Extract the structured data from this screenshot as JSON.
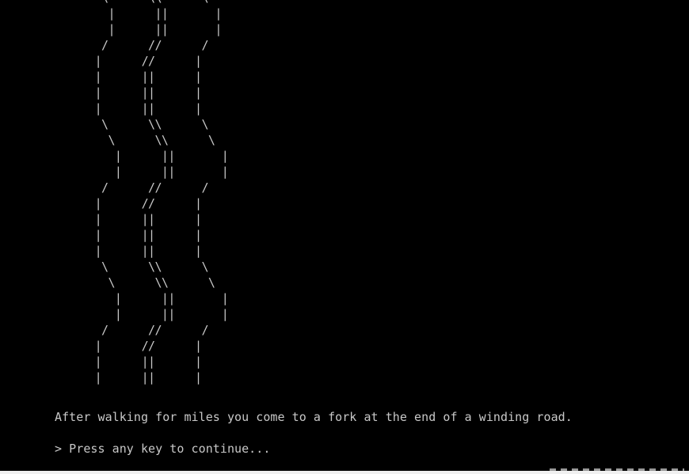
{
  "console": {
    "ascii_art": "       \\      \\\\      \\\n        |      ||       |\n        |      ||       |\n       /      //      /\n      |      //      |\n      |      ||      |\n      |      ||      |\n      |      ||      |\n       \\      \\\\      \\\n        \\      \\\\      \\\n         |      ||       |\n         |      ||       |\n       /      //      /\n      |      //      |\n      |      ||      |\n      |      ||      |\n      |      ||      |\n       \\      \\\\      \\\n        \\      \\\\      \\\n         |      ||       |\n         |      ||       |\n       /      //      /\n      |      //      |\n      |      ||      |\n      |      ||      |",
    "narration": "After walking for miles you come to a fork at the end of a winding road.",
    "prompt": "> Press any key to continue..."
  },
  "colors": {
    "background": "#000000",
    "text": "#c8c8c8"
  }
}
